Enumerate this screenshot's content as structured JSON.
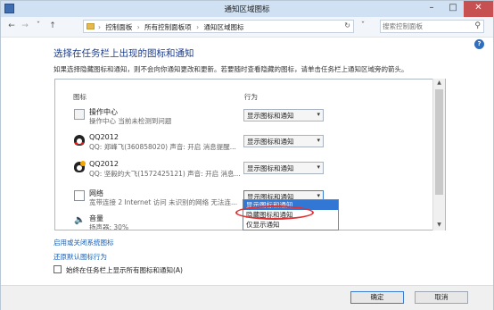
{
  "window": {
    "title": "通知区域图标"
  },
  "address": {
    "breadcrumbs": [
      "控制面板",
      "所有控制面板项",
      "通知区域图标"
    ],
    "separator": "›"
  },
  "search": {
    "placeholder": "搜索控制面板"
  },
  "page": {
    "heading": "选择在任务栏上出现的图标和通知",
    "description": "如果选择隐藏图标和通知，则不会向你通知更改和更新。若要随时查看隐藏的图标，请单击任务栏上通知区域旁的箭头。"
  },
  "columns": {
    "icon": "图标",
    "action": "行为"
  },
  "items": [
    {
      "name": "操作中心",
      "desc": "操作中心 当前未检测到问题",
      "action": "显示图标和通知",
      "icon": "flag-icon"
    },
    {
      "name": "QQ2012",
      "desc": "QQ: 郑峰飞(360858020) 声音: 开启 消息提醒...",
      "action": "显示图标和通知",
      "icon": "qq-penguin-icon"
    },
    {
      "name": "QQ2012",
      "desc": "QQ: 坚毅的大飞(1572425121) 声音: 开启 消息...",
      "action": "显示图标和通知",
      "icon": "qq-penguin-icon"
    },
    {
      "name": "网络",
      "desc": "宽带连接 2 Internet 访问 未识别的网络 无法连...",
      "action": "显示图标和通知",
      "icon": "network-icon"
    },
    {
      "name": "音量",
      "desc": "扬声器: 30%",
      "action": "",
      "icon": "speaker-icon"
    }
  ],
  "dropdown_options": [
    "显示图标和通知",
    "隐藏图标和通知",
    "仅显示通知"
  ],
  "links": {
    "system_icons": "启用或关闭系统图标",
    "restore": "还原默认图标行为"
  },
  "always_show": {
    "label": "始终在任务栏上显示所有图标和通知(A)",
    "checked": false
  },
  "buttons": {
    "ok": "确定",
    "cancel": "取消"
  },
  "colors": {
    "heading": "#1d3c8a",
    "link": "#1a5fb4",
    "selection": "#3277d3",
    "highlight": "#e03232",
    "close": "#c75050"
  }
}
